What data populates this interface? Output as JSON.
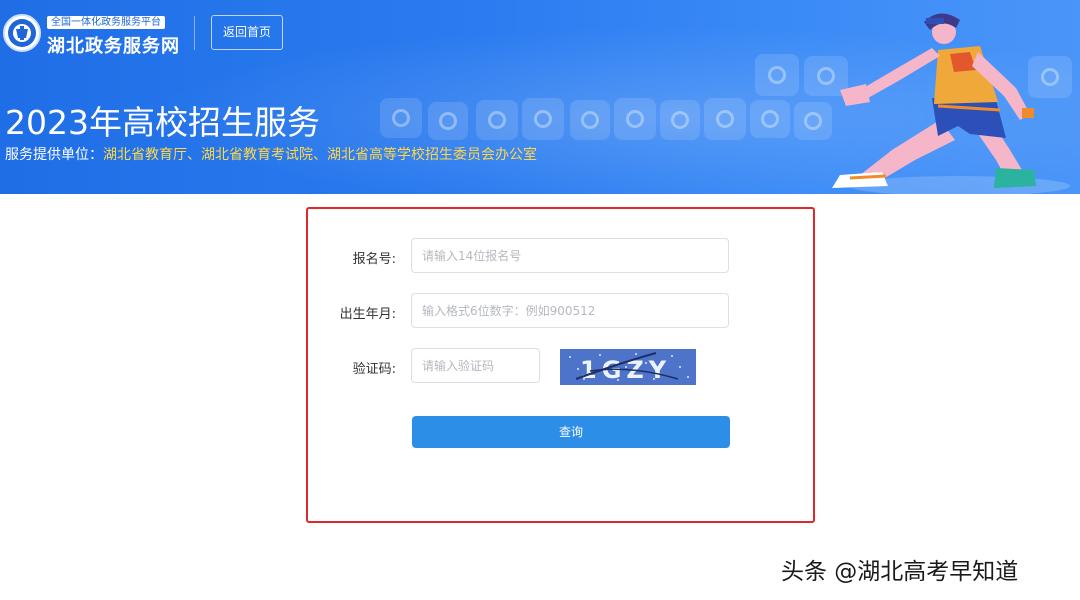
{
  "header": {
    "portal_subtitle": "全国一体化政务服务平台",
    "portal_name": "湖北政务服务网",
    "home_button": "返回首页"
  },
  "hero": {
    "title": "2023年高校招生服务",
    "provider_label": "服务提供单位：",
    "provider_value": "湖北省教育厅、湖北省教育考试院、湖北省高等学校招生委员会办公室"
  },
  "form": {
    "registration_label": "报名号:",
    "registration_placeholder": "请输入14位报名号",
    "registration_value": "",
    "birth_label": "出生年月:",
    "birth_placeholder": "输入格式6位数字：例如900512",
    "birth_value": "",
    "captcha_label": "验证码:",
    "captcha_placeholder": "请输入验证码",
    "captcha_value": "",
    "captcha_image_text": "1GZY",
    "submit_label": "查询"
  },
  "watermark": "头条 @湖北高考早知道",
  "colors": {
    "banner_blue": "#2b7cf0",
    "provider_yellow": "#ffd84a",
    "button_blue": "#2d8ee8",
    "highlight_red": "#e02828"
  }
}
